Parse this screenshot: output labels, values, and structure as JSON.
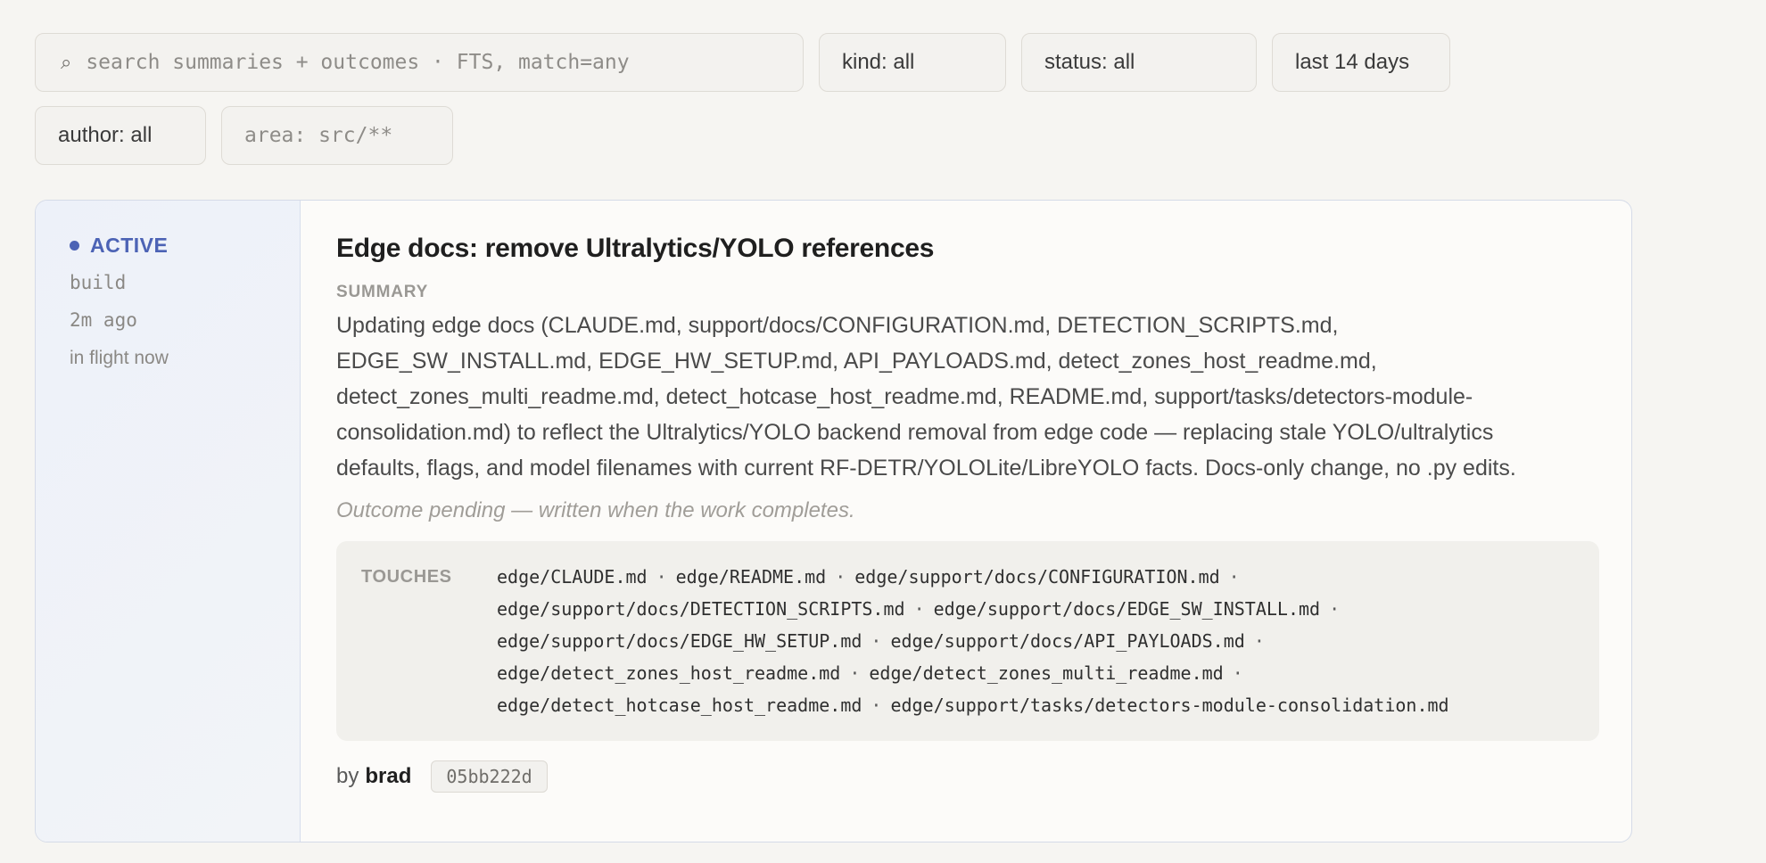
{
  "filters": {
    "search_icon": "⌕",
    "search_placeholder": "search summaries + outcomes · FTS, match=any",
    "kind": "kind: all",
    "status": "status: all",
    "range": "last 14 days",
    "author": "author: all",
    "area_placeholder": "area: src/**"
  },
  "entry": {
    "status": "ACTIVE",
    "status_color": "#4c63b5",
    "kind": "build",
    "age": "2m ago",
    "state": "in flight now",
    "title": "Edge docs: remove Ultralytics/YOLO references",
    "summary_label": "SUMMARY",
    "summary": "Updating edge docs (CLAUDE.md, support/docs/CONFIGURATION.md, DETECTION_SCRIPTS.md, EDGE_SW_INSTALL.md, EDGE_HW_SETUP.md, API_PAYLOADS.md, detect_zones_host_readme.md, detect_zones_multi_readme.md, detect_hotcase_host_readme.md, README.md, support/tasks/detectors-module-consolidation.md) to reflect the Ultralytics/YOLO backend removal from edge code — replacing stale YOLO/ultralytics defaults, flags, and model filenames with current RF-DETR/YOLOLite/LibreYOLO facts. Docs-only change, no .py edits.",
    "outcome": "Outcome pending — written when the work completes.",
    "touches_label": "TOUCHES",
    "touches": [
      "edge/CLAUDE.md",
      "edge/README.md",
      "edge/support/docs/CONFIGURATION.md",
      "edge/support/docs/DETECTION_SCRIPTS.md",
      "edge/support/docs/EDGE_SW_INSTALL.md",
      "edge/support/docs/EDGE_HW_SETUP.md",
      "edge/support/docs/API_PAYLOADS.md",
      "edge/detect_zones_host_readme.md",
      "edge/detect_zones_multi_readme.md",
      "edge/detect_hotcase_host_readme.md",
      "edge/support/tasks/detectors-module-consolidation.md"
    ],
    "by_label": "by",
    "author": "brad",
    "commit": "05bb222d"
  }
}
